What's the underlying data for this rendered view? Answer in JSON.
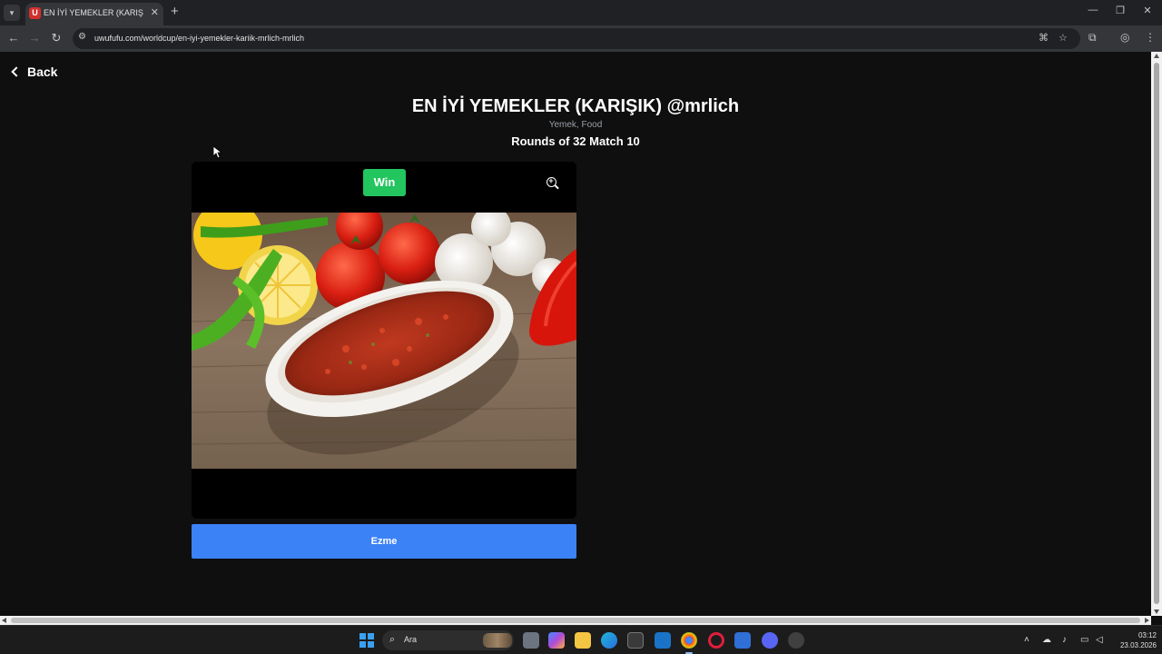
{
  "browser": {
    "tab": {
      "favicon_letter": "U",
      "title": "EN İYİ YEMEKLER (KARIŞIK) @mrlich",
      "close": "✕"
    },
    "new_tab": "+",
    "window_controls": {
      "minimize": "—",
      "restore": "❐",
      "close": "✕"
    },
    "nav": {
      "back": "←",
      "forward": "→",
      "reload": "↻"
    },
    "url": "uwufufu.com/worldcup/en-iyi-yemekler-kariik-mrlich-mrlich"
  },
  "page": {
    "back_label": "Back",
    "title": "EN İYİ YEMEKLER (KARIŞIK) @mrlich",
    "tags": "Yemek, Food",
    "round": "Rounds of 32 Match 10",
    "win_label": "Win",
    "choice_label": "Ezme"
  },
  "taskbar": {
    "search_label": "Ara",
    "clock_time": "03:12",
    "clock_date": "23.03.2026"
  },
  "colors": {
    "win_button": "#22c55e",
    "choice_button": "#3b82f6",
    "page_background": "#0f0f0f"
  },
  "icons": [
    "back-chevron-icon",
    "zoom-in-icon",
    "search-icon",
    "windows-start-icon",
    "translate-icon",
    "bookmark-star-icon",
    "extensions-icon",
    "profile-icon",
    "menu-icon"
  ]
}
